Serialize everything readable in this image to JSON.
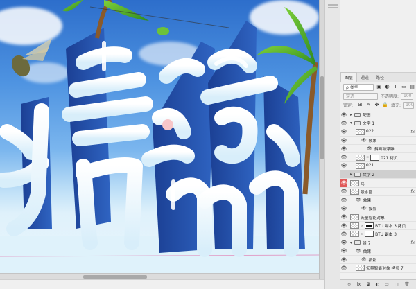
{
  "panel": {
    "tabs": [
      "图层",
      "通道",
      "路径"
    ],
    "filter_kind": "ρ 类型",
    "blend_mode": "穿透",
    "opacity_label": "不透明度:",
    "opacity_value": "100",
    "lock_label": "锁定:",
    "fill_label": "填充:",
    "fill_value": "100"
  },
  "layers": [
    {
      "label": "配图",
      "kind": "folder",
      "indent": 0,
      "visible": true
    },
    {
      "label": "文字 1",
      "kind": "folder-open",
      "indent": 0,
      "visible": true
    },
    {
      "label": "022",
      "kind": "layer",
      "indent": 1,
      "visible": true,
      "fx": true
    },
    {
      "label": "效果",
      "kind": "effects",
      "indent": 2,
      "visible": true
    },
    {
      "label": "斜面和浮雕",
      "kind": "effect",
      "indent": 3,
      "visible": true
    },
    {
      "label": "021 拷贝",
      "kind": "masked",
      "indent": 1,
      "visible": true
    },
    {
      "label": "021",
      "kind": "layer",
      "indent": 1,
      "visible": true
    },
    {
      "label": "文字 2",
      "kind": "folder",
      "indent": 0,
      "visible": false,
      "selected": true
    },
    {
      "label": "鸟",
      "kind": "layer",
      "indent": 0,
      "visible": true,
      "red": true
    },
    {
      "label": "景水圈",
      "kind": "layer",
      "indent": 0,
      "visible": true,
      "fx": true
    },
    {
      "label": "效果",
      "kind": "effects",
      "indent": 1,
      "visible": true
    },
    {
      "label": "投影",
      "kind": "effect",
      "indent": 2,
      "visible": true
    },
    {
      "label": "矢量智能对象",
      "kind": "layer",
      "indent": 0,
      "visible": true
    },
    {
      "label": "BTU 副本 3 拷贝",
      "kind": "masked-dark",
      "indent": 0,
      "visible": true
    },
    {
      "label": "BTU 副本 3",
      "kind": "masked",
      "indent": 0,
      "visible": true
    },
    {
      "label": "组 7",
      "kind": "folder-open",
      "indent": 0,
      "visible": true,
      "fx": true
    },
    {
      "label": "效果",
      "kind": "effects",
      "indent": 1,
      "visible": true
    },
    {
      "label": "投影",
      "kind": "effect",
      "indent": 2,
      "visible": true
    },
    {
      "label": "矢量智能对象 拷贝 7",
      "kind": "layer",
      "indent": 1,
      "visible": true
    }
  ],
  "footer_icons": [
    "link-icon",
    "fx-icon",
    "mask-icon",
    "adjustment-icon",
    "folder-icon",
    "new-layer-icon",
    "trash-icon"
  ],
  "footer_glyphs": [
    "∞",
    "fx",
    "◘",
    "◐",
    "▭",
    "▢",
    "🗑"
  ],
  "canvas": {
    "artwork_glyphs": "清凉"
  }
}
